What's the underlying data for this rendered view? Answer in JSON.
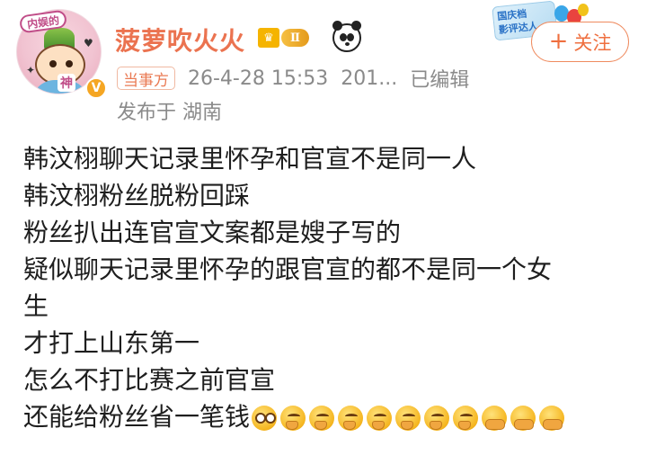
{
  "post": {
    "author": {
      "name": "菠萝吹火火",
      "level": "Ⅱ",
      "avatar_tag": "内娱的",
      "avatar_caption": "神",
      "verified": "V"
    },
    "topic_badge": {
      "line1": "国庆档",
      "line2": "影评达人"
    },
    "follow_button": {
      "icon": "+",
      "label": "关注"
    },
    "meta": {
      "source": "当事方",
      "timestamp": "26-4-28 15:53",
      "truncated_info": "201...",
      "edited": "已编辑",
      "location": "发布于 湖南"
    },
    "content_lines": [
      "韩汶栩聊天记录里怀孕和官宣不是同一人",
      "韩汶栩粉丝脱粉回踩",
      "粉丝扒出连官宣文案都是嫂子写的",
      "疑似聊天记录里怀孕的跟官宣的都不是同一个女",
      "生",
      "才打上山东第一",
      "怎么不打比赛之前官宣",
      "还能给粉丝省一笔钱"
    ],
    "trailing_emojis": [
      "eyes-emoji",
      "thinking-emoji",
      "thinking-emoji",
      "thinking-emoji",
      "thinking-emoji",
      "thinking-emoji",
      "thinking-emoji",
      "thinking-emoji",
      "hands-emoji",
      "hands-emoji",
      "hands-emoji"
    ]
  },
  "colors": {
    "username": "#eb7350",
    "accent": "#ef6f3f",
    "meta_gray": "#8a8a8a",
    "text": "#1e1e1e"
  }
}
